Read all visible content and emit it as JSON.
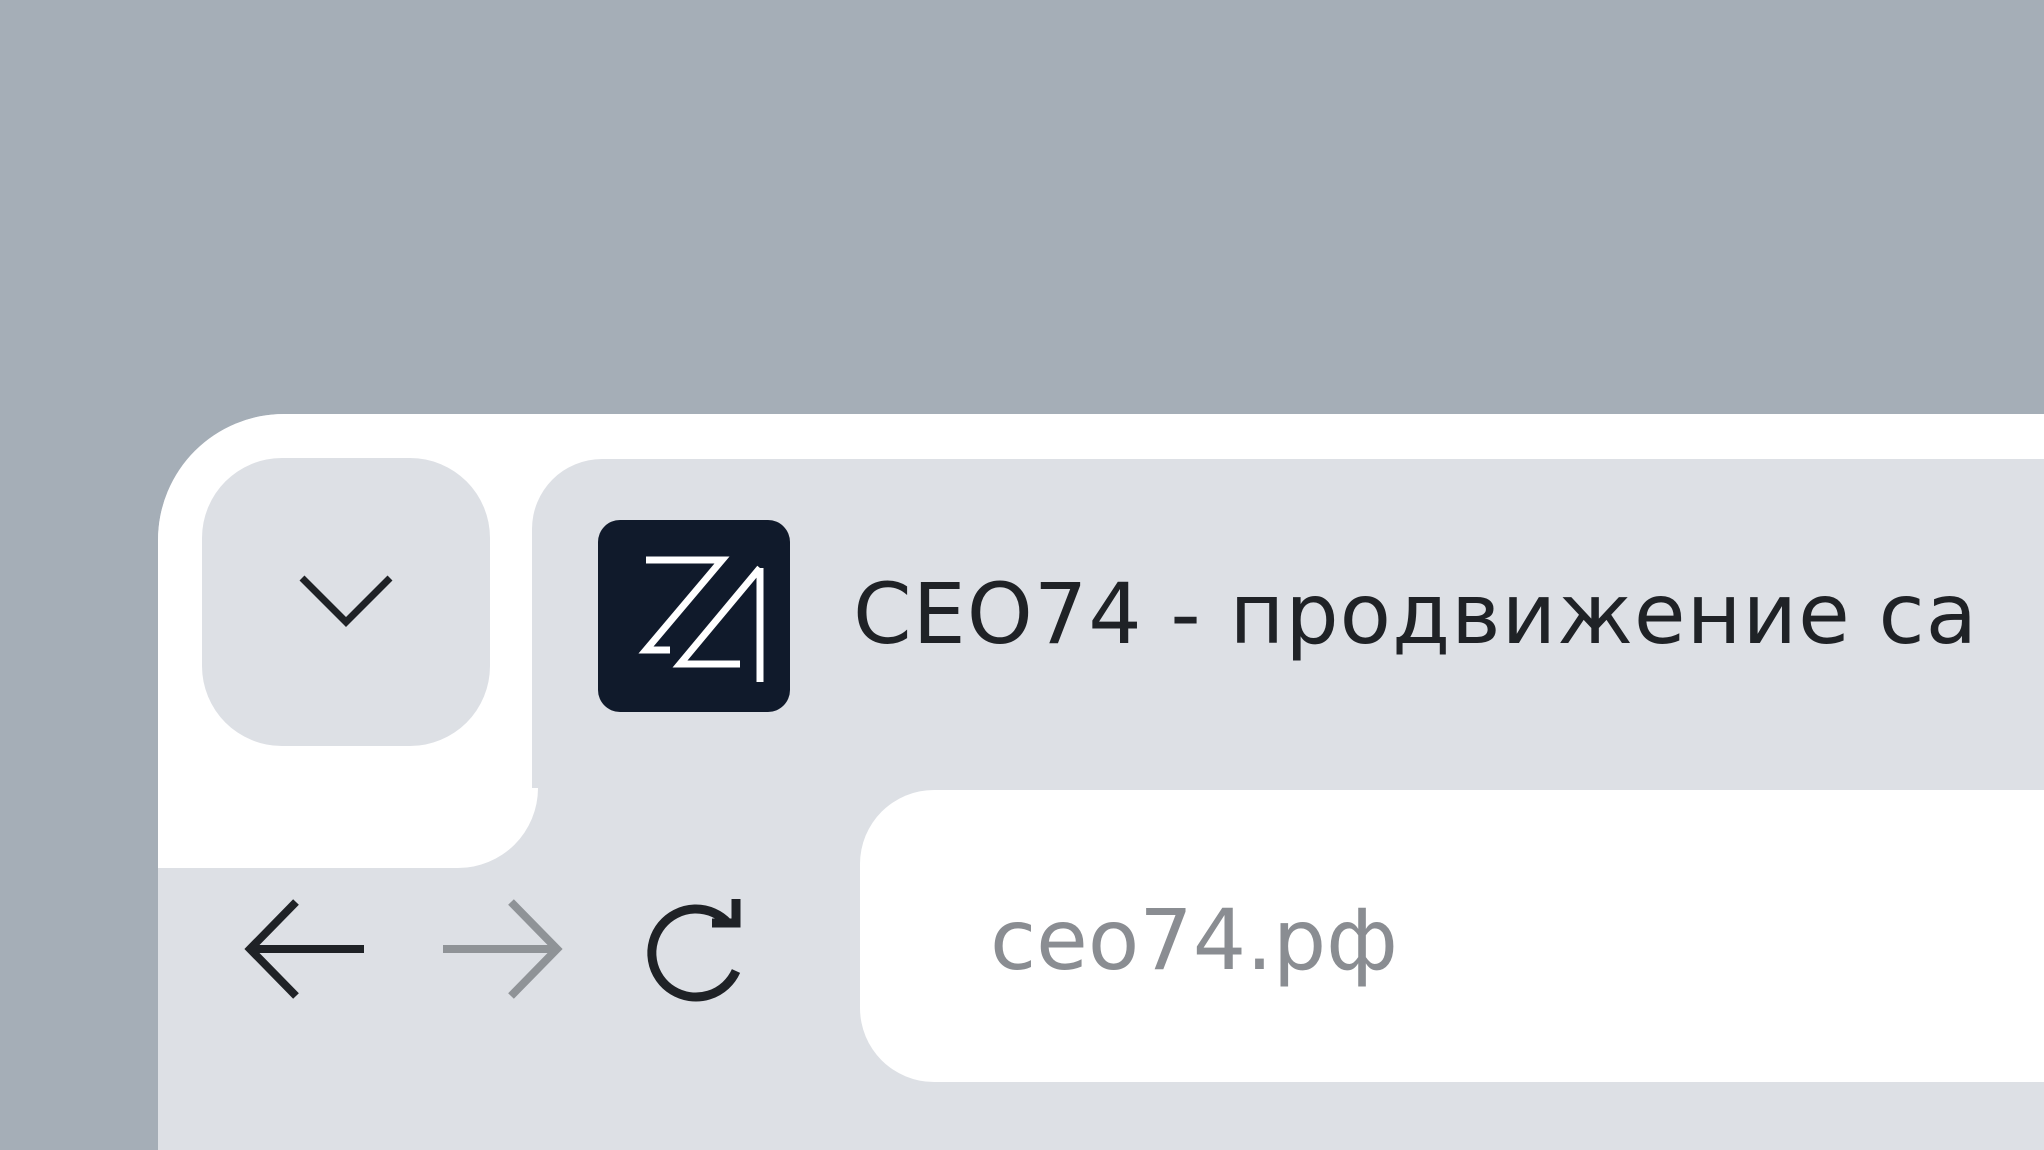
{
  "tab": {
    "title": "CEO74 - продвижение са",
    "favicon_icon": "ceo74-logo-icon"
  },
  "toolbar": {
    "tab_list_icon": "chevron-down-icon",
    "back_icon": "arrow-left-icon",
    "forward_icon": "arrow-right-icon",
    "reload_icon": "reload-icon"
  },
  "address_bar": {
    "url": "сео74.рф"
  },
  "colors": {
    "desktop": "#a5aeb7",
    "chrome": "#dde0e5",
    "tabstrip": "#ffffff",
    "favicon_bg": "#101a2b",
    "text_primary": "#1f2226",
    "text_muted": "#8a8d92"
  }
}
